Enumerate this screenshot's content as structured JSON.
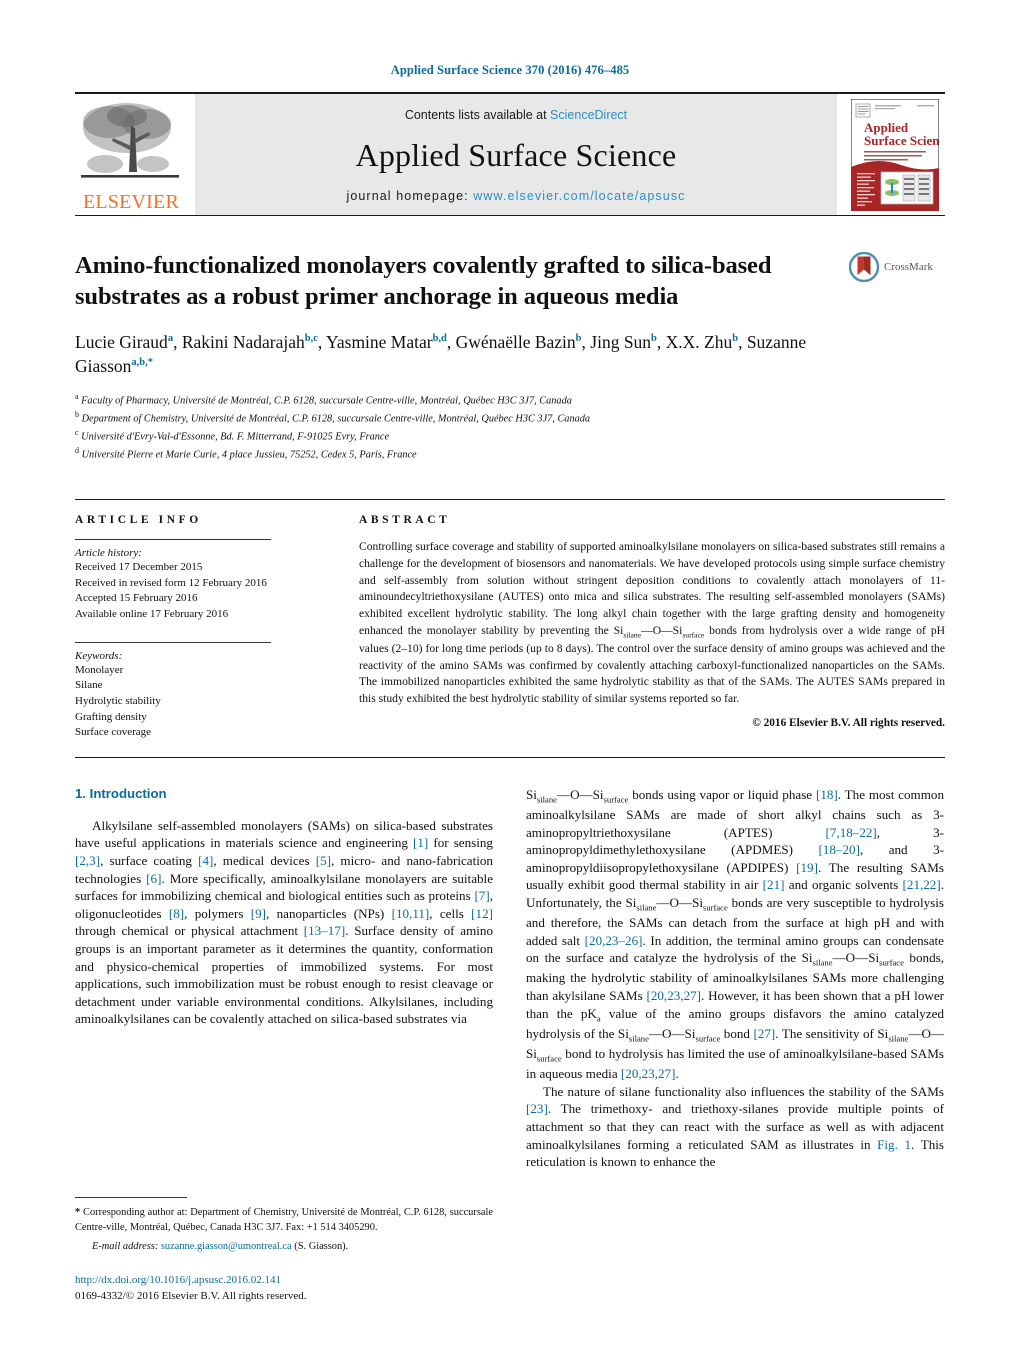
{
  "running_head": "Applied Surface Science 370 (2016) 476–485",
  "masthead": {
    "publisher": "ELSEVIER",
    "contents_prefix": "Contents lists available at ",
    "contents_link": "ScienceDirect",
    "journal_title": "Applied Surface Science",
    "homepage_prefix": "journal homepage: ",
    "homepage_url": "www.elsevier.com/locate/apsusc",
    "cover_title_line1": "Applied",
    "cover_title_line2": "Surface Science"
  },
  "article": {
    "title": "Amino-functionalized monolayers covalently grafted to silica-based substrates as a robust primer anchorage in aqueous media",
    "crossmark_label": "CrossMark",
    "authors_html": "Lucie Giraud<sup>a</sup>, Rakini Nadarajah<sup>b,c</sup>, Yasmine Matar<sup>b,d</sup>, Gwénaëlle Bazin<sup>b</sup>, Jing Sun<sup>b</sup>, X.X. Zhu<sup>b</sup>, Suzanne Giasson<sup>a,b,*</sup>",
    "affiliations": [
      {
        "mark": "a",
        "text": "Faculty of Pharmacy, Université de Montréal, C.P. 6128, succursale Centre-ville, Montréal, Québec H3C 3J7, Canada"
      },
      {
        "mark": "b",
        "text": "Department of Chemistry, Université de Montréal, C.P. 6128, succursale Centre-ville, Montréal, Québec H3C 3J7, Canada"
      },
      {
        "mark": "c",
        "text": "Université d'Evry-Val-d'Essonne, Bd. F. Mitterrand, F-91025 Evry, France"
      },
      {
        "mark": "d",
        "text": "Université Pierre et Marie Curie, 4 place Jussieu, 75252, Cedex 5, Paris, France"
      }
    ]
  },
  "article_info": {
    "heading": "ARTICLE INFO",
    "history_label": "Article history:",
    "history": [
      "Received 17 December 2015",
      "Received in revised form 12 February 2016",
      "Accepted 15 February 2016",
      "Available online 17 February 2016"
    ],
    "keywords_label": "Keywords:",
    "keywords": [
      "Monolayer",
      "Silane",
      "Hydrolytic stability",
      "Grafting density",
      "Surface coverage"
    ]
  },
  "abstract": {
    "heading": "ABSTRACT",
    "body_html": "Controlling surface coverage and stability of supported aminoalkylsilane monolayers on silica-based substrates still remains a challenge for the development of biosensors and nanomaterials. We have developed protocols using simple surface chemistry and self-assembly from solution without stringent deposition conditions to covalently attach monolayers of 11-aminoundecyltriethoxysilane (AUTES) onto mica and silica substrates. The resulting self-assembled monolayers (SAMs) exhibited excellent hydrolytic stability. The long alkyl chain together with the large grafting density and homogeneity enhanced the monolayer stability by preventing the Si<sub>silane</sub>&#8212;O&#8212;Si<sub>surface</sub> bonds from hydrolysis over a wide range of pH values (2&#8211;10) for long time periods (up to 8 days). The control over the surface density of amino groups was achieved and the reactivity of the amino SAMs was confirmed by covalently attaching carboxyl-functionalized nanoparticles on the SAMs. The immobilized nanoparticles exhibited the same hydrolytic stability as that of the SAMs. The AUTES SAMs prepared in this study exhibited the best hydrolytic stability of similar systems reported so far.",
    "copyright": "© 2016 Elsevier B.V. All rights reserved."
  },
  "introduction": {
    "heading": "1.  Introduction",
    "left_paragraph_html": "Alkylsilane self-assembled monolayers (SAMs) on silica-based substrates have useful applications in materials science and engineering <span class=\"ref\">[1]</span> for sensing <span class=\"ref\">[2,3]</span>, surface coating <span class=\"ref\">[4]</span>, medical devices <span class=\"ref\">[5]</span>, micro- and nano-fabrication technologies <span class=\"ref\">[6]</span>. More specifically, aminoalkylsilane monolayers are suitable surfaces for immobilizing chemical and biological entities such as proteins <span class=\"ref\">[7]</span>, oligonucleotides <span class=\"ref\">[8]</span>, polymers <span class=\"ref\">[9]</span>, nanoparticles (NPs) <span class=\"ref\">[10,11]</span>, cells <span class=\"ref\">[12]</span> through chemical or physical attachment <span class=\"ref\">[13&#8211;17]</span>. Surface density of amino groups is an important parameter as it determines the quantity, conformation and physico-chemical properties of immobilized systems. For most applications, such immobilization must be robust enough to resist cleavage or detachment under variable environmental conditions. Alkylsilanes, including aminoalkylsilanes can be covalently attached on silica-based substrates via",
    "right_paragraph_1_html": "Si<sub>silane</sub>&#8212;O&#8212;Si<sub>surface</sub> bonds using vapor or liquid phase <span class=\"ref\">[18]</span>. The most common aminoalkylsilane SAMs are made of short alkyl chains such as 3-aminopropyltriethoxysilane (APTES) <span class=\"ref\">[7,18&#8211;22]</span>, 3-aminopropyldimethylethoxysilane (APDMES) <span class=\"ref\">[18&#8211;20]</span>, and 3-aminopropyldiisopropylethoxysilane (APDIPES) <span class=\"ref\">[19]</span>. The resulting SAMs usually exhibit good thermal stability in air <span class=\"ref\">[21]</span> and organic solvents <span class=\"ref\">[21,22]</span>. Unfortunately, the Si<sub>silane</sub>&#8212;O&#8212;Si<sub>surface</sub> bonds are very susceptible to hydrolysis and therefore, the SAMs can detach from the surface at high pH and with added salt <span class=\"ref\">[20,23&#8211;26]</span>. In addition, the terminal amino groups can condensate on the surface and catalyze the hydrolysis of the Si<sub>silane</sub>&#8212;O&#8212;Si<sub>surface</sub> bonds, making the hydrolytic stability of aminoalkylsilanes SAMs more challenging than akylsilane SAMs <span class=\"ref\">[20,23,27]</span>. However, it has been shown that a pH lower than the pK<sub>a</sub> value of the amino groups disfavors the amino catalyzed hydrolysis of the Si<sub>silane</sub>&#8212;O&#8212;Si<sub>surface</sub> bond <span class=\"ref\">[27]</span>. The sensitivity of Si<sub>silane</sub>&#8212;O&#8212;Si<sub>surface</sub> bond to hydrolysis has limited the use of aminoalkylsilane-based SAMs in aqueous media <span class=\"ref\">[20,23,27]</span>.",
    "right_paragraph_2_html": "The nature of silane functionality also influences the stability of the SAMs <span class=\"ref\">[23]</span>. The trimethoxy- and triethoxy-silanes provide multiple points of attachment so that they can react with the surface as well as with adjacent aminoalkylsilanes forming a reticulated SAM as illustrates in <span class=\"ref\">Fig. 1</span>. This reticulation is known to enhance the"
  },
  "footnote": {
    "corresponding_html": "<b>*</b>  Corresponding author at: Department of Chemistry, Université de Montréal, C.P. 6128, succursale Centre-ville, Montréal, Québec, Canada H3C 3J7. Fax: +1 514 3405290.",
    "email_label": "E-mail address:",
    "email": "suzanne.giasson@umontreal.ca",
    "email_suffix": "(S. Giasson).",
    "doi": "http://dx.doi.org/10.1016/j.apsusc.2016.02.141",
    "issn": "0169-4332/© 2016 Elsevier B.V. All rights reserved."
  },
  "colors": {
    "link_blue": "#0b6b9c",
    "sciencedirect_blue": "#2b8fc4",
    "elsevier_orange": "#ee7326",
    "masthead_grey": "#e8e8e8",
    "cover_red": "#a82626"
  }
}
